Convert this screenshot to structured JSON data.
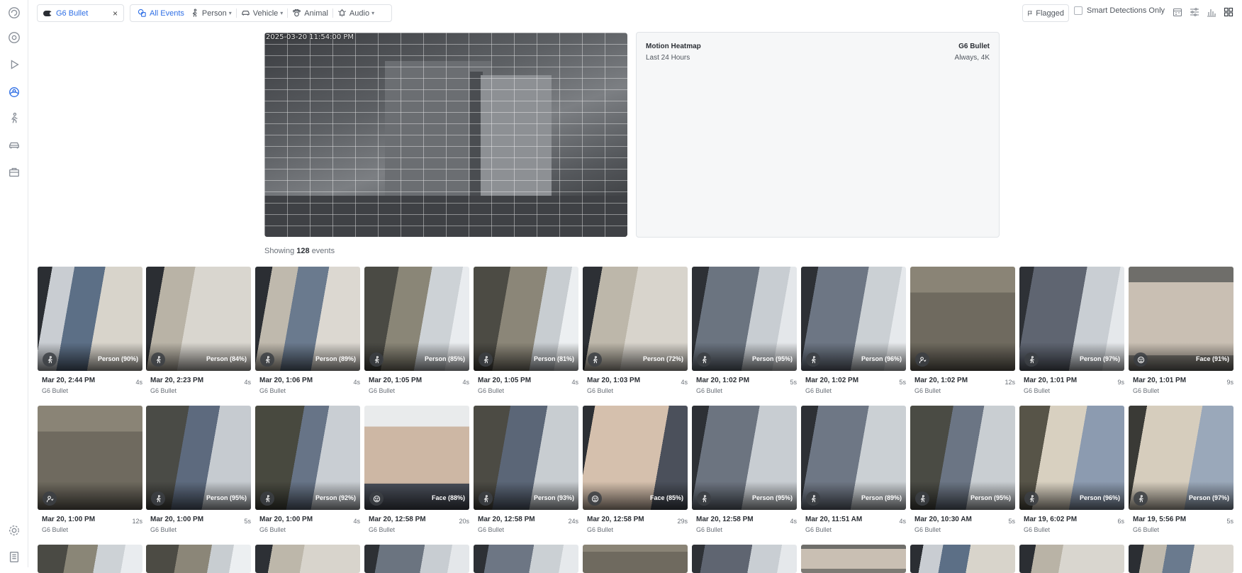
{
  "camera_chip": {
    "label": "G6 Bullet"
  },
  "filters": [
    {
      "label": "All Events",
      "icon": "all-events-icon",
      "active": true,
      "dropdown": false
    },
    {
      "label": "Person",
      "icon": "person-icon",
      "active": false,
      "dropdown": true
    },
    {
      "label": "Vehicle",
      "icon": "vehicle-icon",
      "active": false,
      "dropdown": true
    },
    {
      "label": "Animal",
      "icon": "animal-icon",
      "active": false,
      "dropdown": false
    },
    {
      "label": "Audio",
      "icon": "audio-icon",
      "active": false,
      "dropdown": true
    }
  ],
  "toolbar": {
    "flagged": "Flagged",
    "smart_only": "Smart Detections Only"
  },
  "preview": {
    "timestamp": "2025-03-20 11:54:00 PM"
  },
  "heatmap": {
    "title": "Motion Heatmap",
    "range": "Last 24 Hours",
    "camera": "G6 Bullet",
    "mode": "Always, 4K"
  },
  "showing": {
    "prefix": "Showing",
    "count": "128",
    "suffix": "events"
  },
  "colors": {
    "accent": "#2f6fe5"
  },
  "events": [
    {
      "time": "Mar 20, 2:44 PM",
      "camera": "G6 Bullet",
      "duration": "4s",
      "label": "Person (90%)",
      "icon": "person"
    },
    {
      "time": "Mar 20, 2:23 PM",
      "camera": "G6 Bullet",
      "duration": "4s",
      "label": "Person (84%)",
      "icon": "person"
    },
    {
      "time": "Mar 20, 1:06 PM",
      "camera": "G6 Bullet",
      "duration": "4s",
      "label": "Person (89%)",
      "icon": "person"
    },
    {
      "time": "Mar 20, 1:05 PM",
      "camera": "G6 Bullet",
      "duration": "4s",
      "label": "Person (85%)",
      "icon": "person"
    },
    {
      "time": "Mar 20, 1:05 PM",
      "camera": "G6 Bullet",
      "duration": "4s",
      "label": "Person (81%)",
      "icon": "person"
    },
    {
      "time": "Mar 20, 1:03 PM",
      "camera": "G6 Bullet",
      "duration": "4s",
      "label": "Person (72%)",
      "icon": "person"
    },
    {
      "time": "Mar 20, 1:02 PM",
      "camera": "G6 Bullet",
      "duration": "5s",
      "label": "Person (95%)",
      "icon": "person"
    },
    {
      "time": "Mar 20, 1:02 PM",
      "camera": "G6 Bullet",
      "duration": "5s",
      "label": "Person (96%)",
      "icon": "person"
    },
    {
      "time": "Mar 20, 1:02 PM",
      "camera": "G6 Bullet",
      "duration": "12s",
      "label": "",
      "icon": "motion"
    },
    {
      "time": "Mar 20, 1:01 PM",
      "camera": "G6 Bullet",
      "duration": "9s",
      "label": "Person (97%)",
      "icon": "person"
    },
    {
      "time": "Mar 20, 1:01 PM",
      "camera": "G6 Bullet",
      "duration": "9s",
      "label": "Face (91%)",
      "icon": "face"
    },
    {
      "time": "Mar 20, 1:00 PM",
      "camera": "G6 Bullet",
      "duration": "12s",
      "label": "",
      "icon": "motion"
    },
    {
      "time": "Mar 20, 1:00 PM",
      "camera": "G6 Bullet",
      "duration": "5s",
      "label": "Person (95%)",
      "icon": "person"
    },
    {
      "time": "Mar 20, 1:00 PM",
      "camera": "G6 Bullet",
      "duration": "4s",
      "label": "Person (92%)",
      "icon": "person"
    },
    {
      "time": "Mar 20, 12:58 PM",
      "camera": "G6 Bullet",
      "duration": "20s",
      "label": "Face (88%)",
      "icon": "face"
    },
    {
      "time": "Mar 20, 12:58 PM",
      "camera": "G6 Bullet",
      "duration": "24s",
      "label": "Person (93%)",
      "icon": "person"
    },
    {
      "time": "Mar 20, 12:58 PM",
      "camera": "G6 Bullet",
      "duration": "29s",
      "label": "Face (85%)",
      "icon": "face"
    },
    {
      "time": "Mar 20, 12:58 PM",
      "camera": "G6 Bullet",
      "duration": "4s",
      "label": "Person (95%)",
      "icon": "person"
    },
    {
      "time": "Mar 20, 11:51 AM",
      "camera": "G6 Bullet",
      "duration": "4s",
      "label": "Person (89%)",
      "icon": "person"
    },
    {
      "time": "Mar 20, 10:30 AM",
      "camera": "G6 Bullet",
      "duration": "5s",
      "label": "Person (95%)",
      "icon": "person"
    },
    {
      "time": "Mar 19, 6:02 PM",
      "camera": "G6 Bullet",
      "duration": "6s",
      "label": "Person (96%)",
      "icon": "person"
    },
    {
      "time": "Mar 19, 5:56 PM",
      "camera": "G6 Bullet",
      "duration": "5s",
      "label": "Person (97%)",
      "icon": "person"
    }
  ]
}
